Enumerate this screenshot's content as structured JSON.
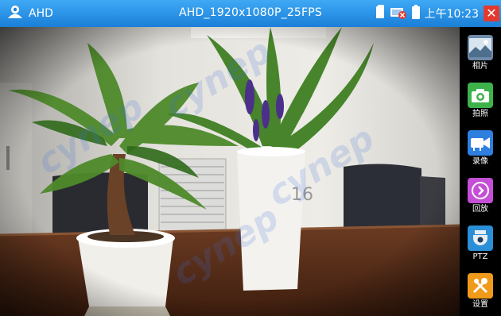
{
  "app": {
    "name": "AHD",
    "icon": "camera-user-icon"
  },
  "header": {
    "title": "AHD_1920x1080P_25FPS"
  },
  "status": {
    "icons": [
      "sd-card-icon",
      "network-disconnected-icon",
      "battery-icon"
    ],
    "time": "上午10:23",
    "close_icon": "close-icon"
  },
  "sidebar": {
    "items": [
      {
        "label": "相片",
        "icon": "photo-album-icon",
        "color": "#6e8aa8"
      },
      {
        "label": "拍照",
        "icon": "camera-icon",
        "color": "#3db24a"
      },
      {
        "label": "录像",
        "icon": "video-camera-icon",
        "color": "#2f7fe0"
      },
      {
        "label": "回放",
        "icon": "playback-icon",
        "color": "#c44fd6"
      },
      {
        "label": "PTZ",
        "icon": "ptz-dome-icon",
        "color": "#2b8fd8"
      },
      {
        "label": "设置",
        "icon": "settings-tools-icon",
        "color": "#f09a1a"
      }
    ]
  },
  "scene": {
    "cup_text": "16"
  },
  "watermark": {
    "text": "cynep"
  },
  "colors": {
    "topbar": "#1a7fd8",
    "close": "#e23a2f"
  }
}
